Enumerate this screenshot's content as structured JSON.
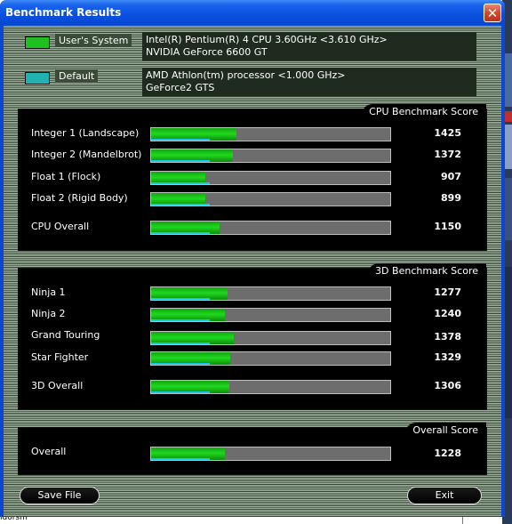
{
  "window": {
    "title": "Benchmark Results",
    "close_glyph": "✕"
  },
  "systems": [
    {
      "label": "User's System",
      "color": "#1fbf1f",
      "line1": "Intel(R) Pentium(R) 4 CPU 3.60GHz <3.610 GHz>",
      "line2": "NVIDIA GeForce 6600 GT"
    },
    {
      "label": "Default",
      "color": "#23b2b2",
      "line1": "AMD Athlon(tm) processor <1.000 GHz>",
      "line2": "GeForce2 GTS"
    }
  ],
  "cpu": {
    "title": "CPU Benchmark Score",
    "rows": [
      {
        "label": "Integer 1 (Landscape)",
        "score": "1425",
        "level": 0.356,
        "default_level": 0.245
      },
      {
        "label": "Integer 2 (Mandelbrot)",
        "score": "1372",
        "level": 0.343,
        "default_level": 0.245
      },
      {
        "label": "Float 1 (Flock)",
        "score": "907",
        "level": 0.227,
        "default_level": 0.245
      },
      {
        "label": "Float 2 (Rigid Body)",
        "score": "899",
        "level": 0.225,
        "default_level": 0.245
      }
    ],
    "overall": {
      "label": "CPU Overall",
      "score": "1150",
      "level": 0.288,
      "default_level": 0.245
    }
  },
  "d3": {
    "title": "3D Benchmark Score",
    "rows": [
      {
        "label": "Ninja 1",
        "score": "1277",
        "level": 0.319,
        "default_level": 0.245
      },
      {
        "label": "Ninja 2",
        "score": "1240",
        "level": 0.31,
        "default_level": 0.245
      },
      {
        "label": "Grand Touring",
        "score": "1378",
        "level": 0.345,
        "default_level": 0.245
      },
      {
        "label": "Star Fighter",
        "score": "1329",
        "level": 0.332,
        "default_level": 0.245
      }
    ],
    "overall": {
      "label": "3D Overall",
      "score": "1306",
      "level": 0.327,
      "default_level": 0.245
    }
  },
  "overall": {
    "title": "Overall Score",
    "row": {
      "label": "Overall",
      "score": "1228",
      "level": 0.307,
      "default_level": 0.245
    }
  },
  "buttons": {
    "save": "Save File",
    "exit": "Exit"
  },
  "background": {
    "bottom_text": "ldorsm"
  }
}
